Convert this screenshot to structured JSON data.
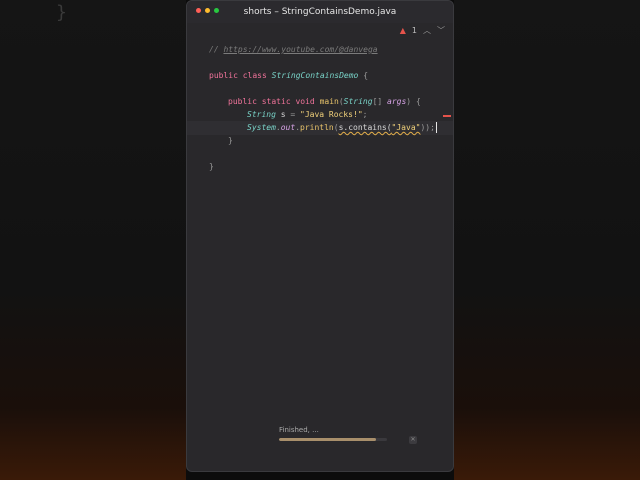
{
  "window": {
    "title": "shorts – StringContainsDemo.java"
  },
  "background": {
    "ghost_brace": "}"
  },
  "inspector": {
    "warning_count": "1",
    "warning_icon": "warning-triangle-icon",
    "up_icon": "chevron-up-icon",
    "down_icon": "chevron-down-icon"
  },
  "code": {
    "comment_prefix": "// ",
    "comment_url": "https://www.youtube.com/@danvega",
    "kw_public": "public",
    "kw_class": "class",
    "kw_static": "static",
    "kw_void": "void",
    "class_name": "StringContainsDemo",
    "open_brace": "{",
    "close_brace": "}",
    "method_name": "main",
    "param_type": "String",
    "param_brackets": "[]",
    "param_name": "args",
    "open_paren": "(",
    "close_paren": ")",
    "var_type": "String",
    "var_name": "s",
    "assign": " = ",
    "str_literal": "\"Java Rocks!\"",
    "semicolon": ";",
    "sys": "System",
    "dot": ".",
    "out": "out",
    "println": "println",
    "contains_call": "s.contains(",
    "contains_arg": "\"Java\"",
    "contains_tail": "));"
  },
  "status": {
    "text": "Finished, ...",
    "progress": 0.9,
    "close_icon": "close-icon"
  },
  "colors": {
    "editor_bg": "#29282b",
    "keyword": "#f0739a",
    "class": "#79d3c8",
    "string": "#f2d27b",
    "warning": "#e5534b"
  }
}
